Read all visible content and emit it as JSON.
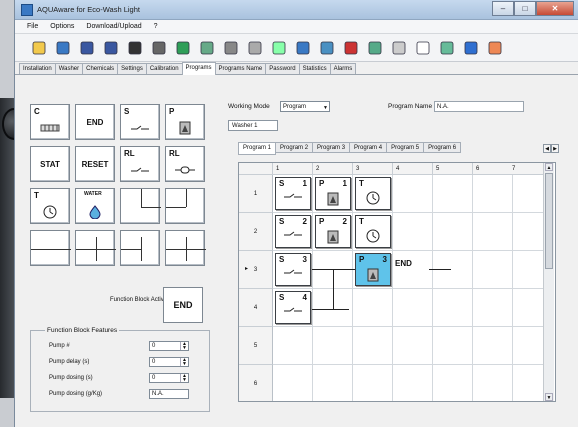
{
  "window": {
    "title": "AQUAware for Eco-Wash Light"
  },
  "menu": [
    "File",
    "Options",
    "Download/Upload",
    "?"
  ],
  "toolbar_icons": [
    "new-icon",
    "info-icon",
    "save-icon",
    "save-as-icon",
    "minus-icon",
    "settings-gear-icon",
    "network-icon",
    "list-icon",
    "plug-icon",
    "arrow-icon",
    "record-icon",
    "grid-icon",
    "drop-icon",
    "tools-icon",
    "chart-icon",
    "lamp-icon",
    "folder-icon",
    "copy-icon",
    "pen-icon",
    "warning-icon"
  ],
  "tabs": [
    "Installation",
    "Washer",
    "Chemicals",
    "Settings",
    "Calibration",
    "Programs",
    "Programs Name",
    "Password",
    "Statistics",
    "Alarms"
  ],
  "active_tab": "Programs",
  "palette": {
    "items": [
      {
        "tag": "C"
      },
      {
        "label": "END"
      },
      {
        "tag": "S"
      },
      {
        "tag": "P"
      },
      {
        "label": "STAT"
      },
      {
        "label": "RESET"
      },
      {
        "tag": "RL"
      },
      {
        "tag": "RL"
      },
      {
        "tag": "T"
      },
      {
        "tag": "WATER"
      }
    ],
    "function_block_active_label": "Function Block Active",
    "end_label": "END"
  },
  "features": {
    "title": "Function Block Features",
    "rows": [
      {
        "name": "Pump #",
        "value": "0",
        "type": "spin"
      },
      {
        "name": "Pump delay (s)",
        "value": "0",
        "type": "spin"
      },
      {
        "name": "Pump dosing (s)",
        "value": "0",
        "type": "spin"
      },
      {
        "name": "Pump dosing (g/Kg)",
        "value": "N.A.",
        "type": "text"
      }
    ]
  },
  "working_mode": {
    "label": "Working Mode",
    "value": "Program"
  },
  "program_name": {
    "label": "Program Name",
    "value": "N.A."
  },
  "washer": "Washer 1",
  "program_tabs": [
    "Program 1",
    "Program 2",
    "Program 3",
    "Program 4",
    "Program 5",
    "Program 6"
  ],
  "grid": {
    "col_headers": [
      "1",
      "2",
      "3",
      "4",
      "5",
      "6",
      "7"
    ],
    "row_headers": [
      "1",
      "2",
      "3",
      "4",
      "5",
      "6"
    ],
    "current_row_marker": "▸",
    "blocks": [
      {
        "row": 1,
        "col": 1,
        "tag": "S",
        "num": "1",
        "icon": "valve-icon"
      },
      {
        "row": 1,
        "col": 2,
        "tag": "P",
        "num": "1",
        "icon": "pump-icon"
      },
      {
        "row": 1,
        "col": 3,
        "tag": "T",
        "num": "",
        "icon": "timer-icon"
      },
      {
        "row": 2,
        "col": 1,
        "tag": "S",
        "num": "2",
        "icon": "valve-icon"
      },
      {
        "row": 2,
        "col": 2,
        "tag": "P",
        "num": "2",
        "icon": "pump-icon"
      },
      {
        "row": 2,
        "col": 3,
        "tag": "T",
        "num": "",
        "icon": "timer-icon"
      },
      {
        "row": 3,
        "col": 1,
        "tag": "S",
        "num": "3",
        "icon": "valve-icon"
      },
      {
        "row": 3,
        "col": 3,
        "tag": "P",
        "num": "3",
        "icon": "pump-icon",
        "selected": true
      },
      {
        "row": 3,
        "col": 4,
        "tag": "END",
        "num": "",
        "icon": ""
      },
      {
        "row": 4,
        "col": 1,
        "tag": "S",
        "num": "4",
        "icon": "valve-icon"
      }
    ]
  }
}
